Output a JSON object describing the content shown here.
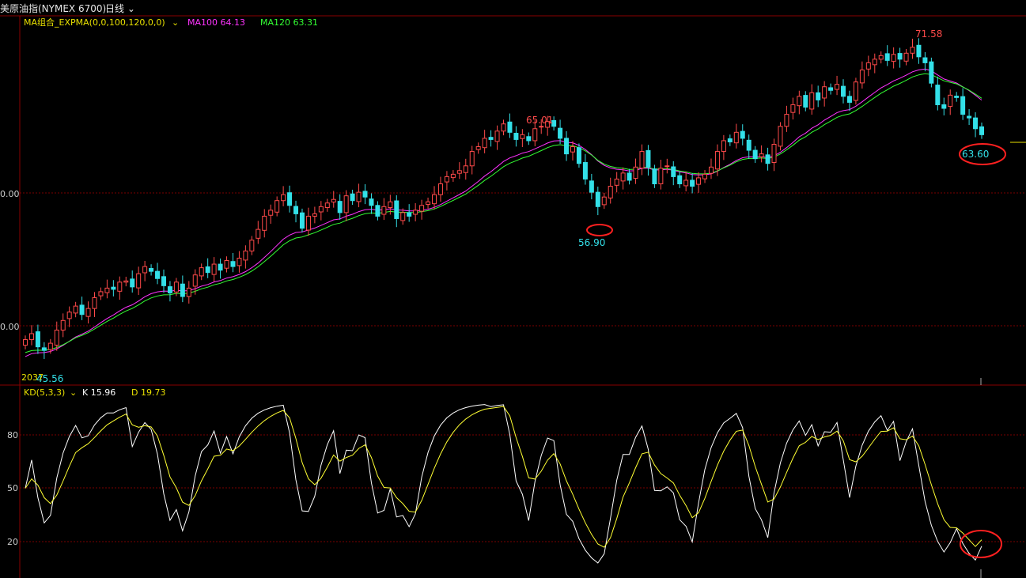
{
  "header": {
    "instrument": "美原油指(NYMEX 6700)",
    "period": "日线",
    "period_chevron": "chevron-down-icon"
  },
  "main_panel": {
    "indicator_name": "MA组合_EXPMA(0,0,100,120,0,0)",
    "ma100_label": "MA100 64.13",
    "ma120_label": "MA120 63.31",
    "price_axis_labels": [
      "0.00",
      "0.00"
    ],
    "high_label": "71.58",
    "mid_high_label": "65.01",
    "low_mid_label": "56.90",
    "last_low_label": "63.60",
    "start_low_label": "45.56",
    "start_tag": "2037"
  },
  "kd_panel": {
    "indicator_name": "KD(5,3,3)",
    "k_label": "K 15.96",
    "d_label": "D 19.73",
    "axis_labels": [
      "80",
      "50",
      "20"
    ]
  },
  "colors": {
    "up": "#ff4a4a",
    "down": "#33e0e8",
    "ma100": "#ff33ff",
    "ma120": "#33ff33",
    "k_line": "#ffffff",
    "d_line": "#ffff33",
    "grid": "#7a0000",
    "frame": "#8a0000",
    "highlight": "#ff2020"
  },
  "chart_data": {
    "type": "candlestick",
    "title": "美原油指(NYMEX 6700) 日线",
    "x": "trading days",
    "price_close": [
      46.8,
      47.3,
      46.2,
      45.9,
      46.5,
      47.6,
      48.4,
      49.1,
      49.6,
      48.9,
      49.4,
      50.3,
      50.8,
      51.1,
      51.0,
      51.6,
      51.7,
      51.2,
      52.3,
      52.9,
      52.5,
      51.9,
      51.3,
      50.7,
      51.6,
      50.4,
      51.1,
      52.2,
      52.8,
      52.4,
      53.1,
      52.6,
      53.4,
      52.9,
      53.6,
      54.2,
      55.1,
      56.0,
      57.1,
      57.6,
      58.4,
      58.9,
      58.0,
      57.3,
      56.1,
      57.1,
      57.3,
      57.9,
      58.2,
      58.5,
      57.4,
      58.8,
      58.4,
      59.1,
      58.7,
      58.0,
      57.1,
      57.9,
      58.3,
      56.9,
      57.4,
      57.1,
      57.6,
      58.0,
      58.3,
      58.9,
      59.8,
      60.4,
      60.6,
      60.9,
      61.3,
      62.5,
      62.9,
      63.6,
      63.5,
      64.2,
      64.8,
      64.1,
      63.5,
      63.9,
      63.4,
      64.4,
      64.6,
      65.0,
      64.6,
      63.6,
      62.3,
      62.9,
      61.5,
      60.2,
      59.1,
      57.9,
      58.7,
      59.6,
      60.2,
      60.7,
      60.1,
      61.2,
      62.5,
      61.2,
      59.8,
      61.1,
      61.3,
      60.4,
      59.8,
      60.1,
      59.6,
      60.3,
      60.6,
      61.2,
      62.5,
      63.4,
      63.3,
      64.1,
      63.6,
      62.6,
      61.9,
      62.3,
      61.5,
      63.1,
      64.6,
      65.6,
      66.4,
      67.1,
      66.2,
      67.4,
      66.8,
      67.9,
      67.6,
      68.1,
      67.1,
      66.6,
      68.3,
      69.3,
      69.9,
      70.2,
      70.5,
      70.1,
      70.6,
      70.2,
      70.7,
      71.2,
      70.4,
      69.9,
      68.2,
      66.4,
      66.1,
      67.2,
      67.0,
      65.6,
      65.3,
      64.4,
      63.9
    ],
    "kd": {
      "k_last": 15.96,
      "d_last": 19.73,
      "axis_ticks": [
        80,
        50,
        20
      ]
    },
    "annotations": [
      "71.58",
      "65.01",
      "56.90",
      "63.60",
      "45.56"
    ]
  }
}
